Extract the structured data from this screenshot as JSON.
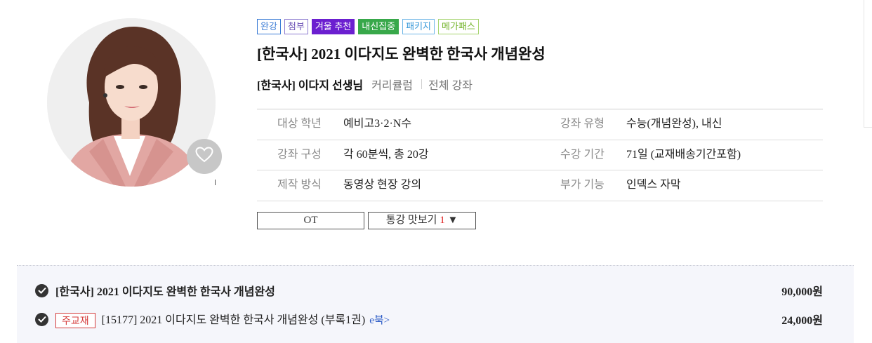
{
  "badges": [
    {
      "label": "완강",
      "color": "#3a7bd5"
    },
    {
      "label": "첨부",
      "color": "#6a4fb5"
    },
    {
      "label": "겨울 추천",
      "color": "#6b1fd0"
    },
    {
      "label": "내신집중",
      "color": "#38a84a"
    },
    {
      "label": "패키지",
      "color": "#3a9ad9"
    },
    {
      "label": "메가패스",
      "color": "#76b52f"
    }
  ],
  "course": {
    "title": "[한국사] 2021 이다지도 완벽한 한국사 개념완성"
  },
  "teacher": {
    "name": "[한국사] 이다지 선생님",
    "curriculum_link": "커리큘럼",
    "all_lectures_link": "전체 강좌"
  },
  "info": [
    {
      "label": "대상 학년",
      "value": "예비고3·2·N수",
      "label2": "강좌 유형",
      "value2": "수능(개념완성), 내신"
    },
    {
      "label": "강좌 구성",
      "value": "각 60분씩, 총 20강",
      "label2": "수강 기간",
      "value2": "71일 (교재배송기간포함)"
    },
    {
      "label": "제작 방식",
      "value": "동영상 현장 강의",
      "label2": "부가 기능",
      "value2": "인덱스 자막"
    }
  ],
  "buttons": {
    "ot": "OT",
    "preview": "통강 맛보기",
    "preview_count": "1",
    "preview_arrow": "▼"
  },
  "purchase": {
    "items": [
      {
        "title": "[한국사] 2021 이다지도 완벽한 한국사 개념완성",
        "price": "90,000원"
      },
      {
        "tag": "주교재",
        "title": "[15177] 2021 이다지도 완벽한 한국사 개념완성 (부록1권)",
        "ebook": "e북>",
        "price": "24,000원"
      }
    ]
  },
  "icons": {
    "favorite": "heart-icon",
    "check": "check-circle-icon"
  }
}
